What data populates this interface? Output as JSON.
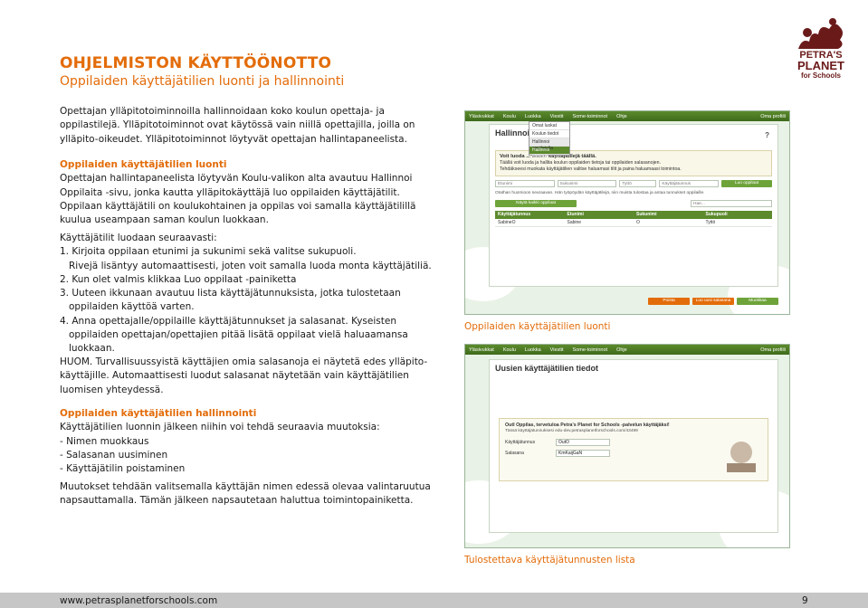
{
  "heading": {
    "title": "OHJELMISTON KÄYTTÖÖNOTTO",
    "subtitle": "Oppilaiden käyttäjätilien luonti ja hallinnointi"
  },
  "logo": {
    "line1": "PETRA'S",
    "line2": "PLANET",
    "line3": "for Schools"
  },
  "intro": {
    "lines": [
      "Opettajan ylläpitotoiminnoilla hallinnoidaan koko koulun opettaja- ja",
      "oppilastilejä. Ylläpitotoiminnot ovat käytössä vain niillä opettajilla, joilla on",
      "ylläpito-oikeudet. Ylläpitotoiminnot löytyvät opettajan hallintapaneelista."
    ]
  },
  "section1": {
    "heading": "Oppilaiden käyttäjätilien luonti",
    "lines": [
      "Opettajan hallintapaneelista löytyvän Koulu-valikon alta avautuu Hallinnoi",
      "Oppilaita -sivu, jonka kautta ylläpitokäyttäjä luo oppilaiden käyttäjätilit.",
      "Oppilaan käyttäjätili on koulukohtainen ja oppilas voi samalla käyttäjätilillä",
      "kuulua useampaan saman koulun luokkaan."
    ]
  },
  "steps": {
    "intro": "Käyttäjätilit luodaan seuraavasti:",
    "lines": [
      "1. Kirjoita oppilaan etunimi ja sukunimi sekä valitse sukupuoli.",
      "Rivejä lisäntyy automaattisesti, joten voit samalla luoda monta käyttäjätiliä.",
      "2. Kun olet valmis klikkaa Luo oppilaat -painiketta",
      "3. Uuteen ikkunaan avautuu lista käyttäjätunnuksista, jotka tulostetaan",
      "oppilaiden käyttöä varten.",
      "4. Anna opettajalle/oppilaille käyttäjätunnukset ja salasanat. Kyseisten",
      "oppilaiden opettajan/opettajien pitää lisätä oppilaat vielä haluaamansa",
      "luokkaan."
    ]
  },
  "huom": {
    "lines": [
      "HUOM. Turvallisuussyistä käyttäjien omia salasanoja ei näytetä edes ylläpito-",
      "käyttäjille. Automaattisesti luodut salasanat näytetään vain käyttäjätilien",
      "luomisen yhteydessä."
    ]
  },
  "section2": {
    "heading": "Oppilaiden käyttäjätilien hallinnointi",
    "lines": [
      "Käyttäjätilien luonnin jälkeen niihin voi tehdä seuraavia muutoksia:",
      "- Nimen muokkaus",
      "- Salasanan uusiminen",
      "- Käyttäjätilin poistaminen"
    ]
  },
  "closing": {
    "lines": [
      "Muutokset tehdään valitsemalla käyttäjän nimen edessä olevaa valintaruutua",
      "napsauttamalla. Tämän jälkeen napsautetaan haluttua toimintopainiketta."
    ]
  },
  "screenshot1": {
    "nav": [
      "Yläsivukkat",
      "Koulu",
      "Luokka",
      "Viestit",
      "Some-toiminnot",
      "Ohje",
      "Oma profiili"
    ],
    "dropdown": [
      "Omat luokat",
      "Koulun tiedot",
      "Hallinnoi opettajalta",
      "Hallinnoi oppilaat"
    ],
    "panel_title": "Hallinnoi o",
    "info_title": "Voit luoda ... laiden käyttäjätilejä täällä.",
    "info_lines": [
      "Täällä voit luoda ja hallita koulun oppilaiden tietoja tai oppilaiden salasanojen.",
      "Tehdäkseesi muokata käyttäjätilien valitse haluamasi tilit ja paina haluamaasi toimintoa."
    ],
    "fields": [
      "Etunimi",
      "Sukunimi",
      "Tyttö",
      "Käyttäjätunnus"
    ],
    "create_button": "Luo oppilaat",
    "note": "Otathan huomioon seuraavan. Hän työpöydän käyttäjätilejä, niin muista tulostaa ja antaa tunnukset oppilaille.",
    "show_all": "Näytä kaikki oppilaat",
    "search_placeholder": "Hae...",
    "table_headers": [
      "Käyttäjätunnus",
      "Etunimi",
      "Sukunimi",
      "Sukupuoli"
    ],
    "table_rows": [
      [
        "SabineO",
        "Sabine",
        "O",
        "Tyttö"
      ]
    ],
    "bottom_buttons": [
      "Poista",
      "Luo uusi salasana",
      "Muokkaa"
    ]
  },
  "screenshot2": {
    "nav": [
      "Yläsivukkat",
      "Koulu",
      "Luokka",
      "Viestit",
      "Some-toiminnot",
      "Ohje",
      "Oma profiili"
    ],
    "panel_title": "Uusien käyttäjätilien tiedot",
    "info_title": "OutI Oppilas, tervetuloa Petra's Planet for Schools -palvelun käyttäjäksi!",
    "info_lines": [
      "Tässä käyttäjätunnuksesi edu-dev.petrasplanetforschools.com/43499"
    ],
    "rows": [
      {
        "label": "Käyttäjätunnus",
        "value": "OutO"
      },
      {
        "label": "Salasana",
        "value": "KmKaijGaN"
      }
    ]
  },
  "captions": {
    "caption1": "Oppilaiden käyttäjätilien luonti",
    "caption2": "Tulostettava käyttäjätunnusten lista"
  },
  "footer": {
    "url": "www.petrasplanetforschools.com",
    "page": "9"
  }
}
